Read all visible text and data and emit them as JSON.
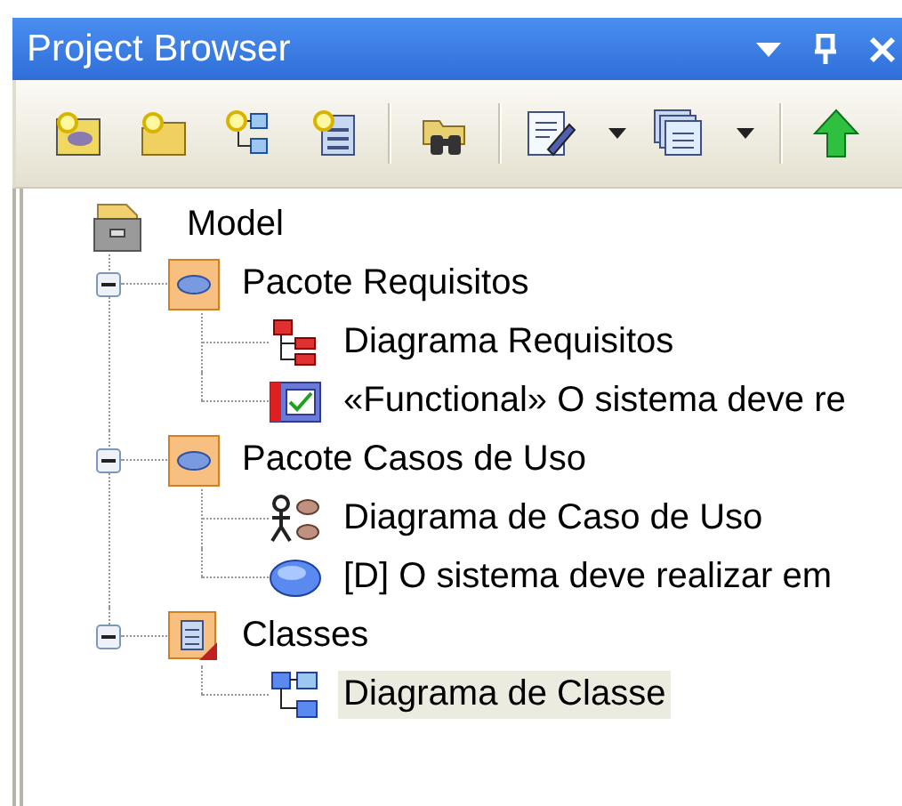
{
  "window": {
    "title": "Project Browser"
  },
  "tree": [
    {
      "kind": "model",
      "label": "Model",
      "selected": false,
      "children": [
        {
          "kind": "package",
          "label": "Pacote Requisitos",
          "selected": false,
          "expanded": true,
          "children": [
            {
              "kind": "requirement-diagram",
              "label": "Diagrama Requisitos",
              "selected": false
            },
            {
              "kind": "requirement",
              "label": "«Functional» O sistema deve re",
              "selected": false
            }
          ]
        },
        {
          "kind": "package",
          "label": "Pacote Casos de Uso",
          "selected": false,
          "expanded": true,
          "children": [
            {
              "kind": "usecase-diagram",
              "label": "Diagrama de Caso de Uso",
              "selected": false
            },
            {
              "kind": "usecase",
              "label": "[D] O sistema deve realizar em",
              "selected": false
            }
          ]
        },
        {
          "kind": "class-package",
          "label": "Classes",
          "selected": false,
          "expanded": true,
          "children": [
            {
              "kind": "class-diagram",
              "label": "Diagrama de Classe",
              "selected": true
            }
          ]
        }
      ]
    }
  ]
}
